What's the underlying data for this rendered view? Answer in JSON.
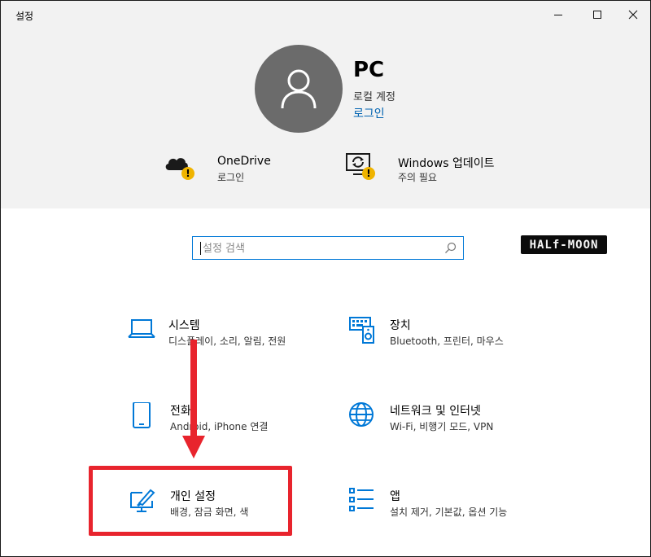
{
  "window": {
    "title": "설정",
    "minimize_icon": "minimize-icon",
    "maximize_icon": "maximize-icon",
    "close_icon": "close-icon"
  },
  "account": {
    "name": "PC",
    "type": "로컬 계정",
    "login_link": "로그인",
    "avatar_icon": "user-icon"
  },
  "status_items": [
    {
      "title": "OneDrive",
      "subtitle": "로그인",
      "icon": "onedrive-cloud-icon",
      "badge": "!"
    },
    {
      "title": "Windows 업데이트",
      "subtitle": "주의 필요",
      "icon": "windows-update-icon",
      "badge": "!"
    }
  ],
  "search": {
    "placeholder": "설정 검색",
    "value": "",
    "icon": "search-icon"
  },
  "watermark": "HALf-MOON",
  "categories": [
    {
      "title": "시스템",
      "subtitle": "디스플레이, 소리, 알림, 전원",
      "icon": "laptop-icon"
    },
    {
      "title": "장치",
      "subtitle": "Bluetooth, 프린터, 마우스",
      "icon": "keyboard-speaker-icon"
    },
    {
      "title": "전화",
      "subtitle": "Android, iPhone 연결",
      "icon": "phone-icon"
    },
    {
      "title": "네트워크 및 인터넷",
      "subtitle": "Wi-Fi, 비행기 모드, VPN",
      "icon": "globe-icon"
    },
    {
      "title": "개인 설정",
      "subtitle": "배경, 잠금 화면, 색",
      "icon": "personalization-brush-icon"
    },
    {
      "title": "앱",
      "subtitle": "설치 제거, 기본값, 옵션 기능",
      "icon": "apps-list-icon"
    }
  ],
  "colors": {
    "accent": "#0078d7",
    "link": "#0063b1",
    "highlight": "#e8242d",
    "warning": "#f0b400",
    "avatar_bg": "#6b6b6b",
    "header_bg": "#f2f2f2"
  }
}
